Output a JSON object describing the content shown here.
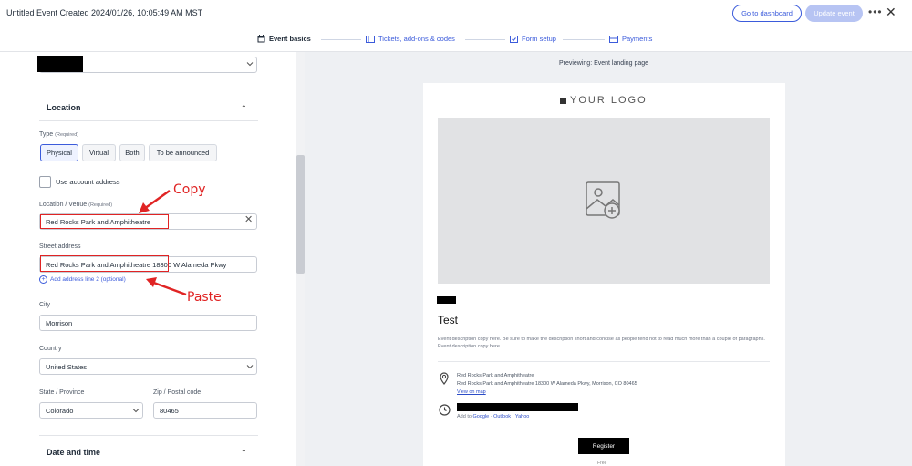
{
  "header": {
    "title": "Untitled Event Created 2024/01/26, 10:05:49 AM MST",
    "dashboard_button": "Go to dashboard",
    "update_button": "Update event",
    "more_icon": "more-horizontal-icon",
    "close_icon": "close-icon"
  },
  "steps": [
    {
      "label": "Event basics",
      "icon": "calendar-icon",
      "active": true
    },
    {
      "label": "Tickets, add-ons & codes",
      "icon": "ticket-icon",
      "active": false
    },
    {
      "label": "Form setup",
      "icon": "form-icon",
      "active": false
    },
    {
      "label": "Payments",
      "icon": "card-icon",
      "active": false
    }
  ],
  "form": {
    "location_section": "Location",
    "type_label": "Type",
    "required_tag": "(Required)",
    "type_options": [
      "Physical",
      "Virtual",
      "Both",
      "To be announced"
    ],
    "type_selected": "Physical",
    "use_account_address": "Use account address",
    "venue_label": "Location / Venue",
    "venue_value": "Red Rocks Park and Amphitheatre",
    "street_label": "Street address",
    "street_value": "Red Rocks Park and Amphitheatre 18300 W Alameda Pkwy",
    "add_line2": "Add address line 2 (optional)",
    "city_label": "City",
    "city_value": "Morrison",
    "country_label": "Country",
    "country_value": "United States",
    "state_label": "State / Province",
    "state_value": "Colorado",
    "zip_label": "Zip / Postal code",
    "zip_value": "80465",
    "date_section": "Date and time"
  },
  "annotations": {
    "copy": "Copy",
    "paste": "Paste",
    "color": "#e02424"
  },
  "preview": {
    "label": "Previewing: Event landing page",
    "logo": "YOUR LOGO",
    "event_title": "Test",
    "description": "Event description copy here. Be sure to make the description short and concise as people tend not to read much more than a couple of paragraphs. Event description copy here.",
    "location_name": "Red Rocks Park and Amphitheatre",
    "location_address": "Red Rocks Park and Amphitheatre 18300 W Alameda Pkwy, Morrison, CO 80465",
    "map_link": "View on map",
    "add_to": "Add to",
    "calendars": [
      "Google",
      "Outlook",
      "Yahoo"
    ],
    "register": "Register",
    "price": "Free"
  },
  "colors": {
    "accent": "#3b5bdb",
    "accent_disabled": "#b7c4f3",
    "preview_bg": "#eef0f3"
  }
}
